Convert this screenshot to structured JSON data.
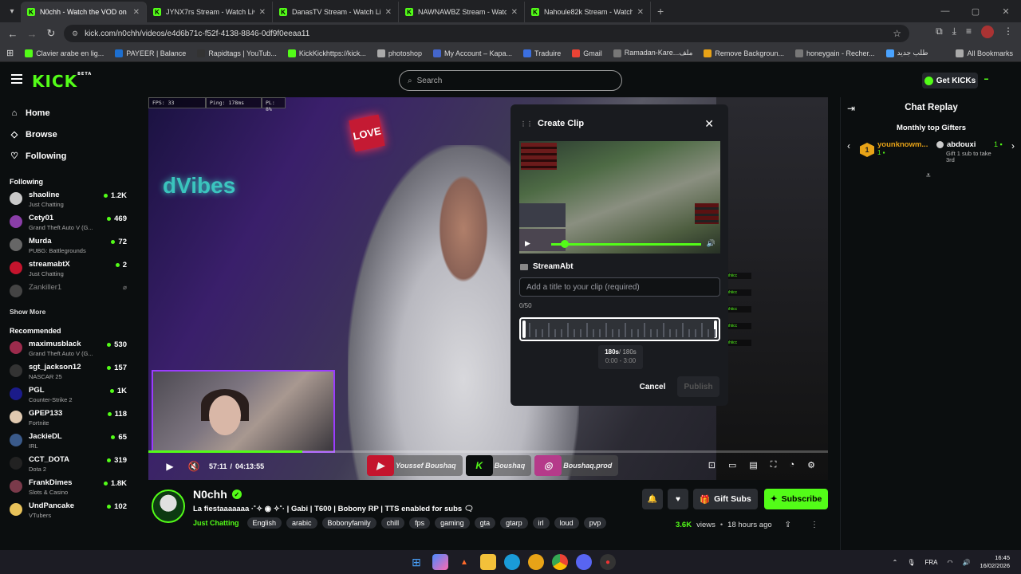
{
  "browser": {
    "tabs": [
      {
        "title": "N0chh - Watch the VOD on Kick",
        "active": true
      },
      {
        "title": "JYNX7rs Stream - Watch Live on",
        "active": false
      },
      {
        "title": "DanasTV Stream - Watch Live o",
        "active": false
      },
      {
        "title": "NAWNAWBZ Stream - Watch Li",
        "active": false
      },
      {
        "title": "Nahoule82k Stream - Watch Liv",
        "active": false
      }
    ],
    "url": "kick.com/n0chh/videos/e4d6b71c-f52f-4138-8846-0df9f0eeaa11",
    "bookmarks": [
      "Clavier arabe en lig...",
      "PAYEER | Balance",
      "Rapidtags | YouTub...",
      "KickKickhttps://kick...",
      "photoshop",
      "My Account – Kapa...",
      "Traduire",
      "Gmail",
      "Ramadan-Kare...ملف",
      "Remove Backgroun...",
      "honeygain - Recher...",
      "طلب جديد"
    ],
    "all_bookmarks": "All Bookmarks"
  },
  "kick": {
    "logo": "KICK",
    "logo_badge": "BETA",
    "search_placeholder": "Search",
    "get_kicks": "Get KICKs",
    "nav": {
      "home": "Home",
      "browse": "Browse",
      "following": "Following"
    },
    "following_title": "Following",
    "following": [
      {
        "name": "shaoline",
        "category": "Just Chatting",
        "viewers": "1.2K",
        "color": "#c9c9c9"
      },
      {
        "name": "Cety01",
        "category": "Grand Theft Auto V (G...",
        "viewers": "469",
        "color": "#8a3ea8"
      },
      {
        "name": "Murda",
        "category": "PUBG: Battlegrounds",
        "viewers": "72",
        "color": "#666"
      },
      {
        "name": "streamabtX",
        "category": "Just Chatting",
        "viewers": "2",
        "color": "#c4142d"
      },
      {
        "name": "Zankiller1",
        "category": "",
        "viewers": "",
        "color": "#444"
      }
    ],
    "show_more": "Show More",
    "recommended_title": "Recommended",
    "recommended": [
      {
        "name": "maximusblack",
        "category": "Grand Theft Auto V (G...",
        "viewers": "530",
        "color": "#9c2b4c"
      },
      {
        "name": "sgt_jackson12",
        "category": "NASCAR 25",
        "viewers": "157",
        "color": "#333"
      },
      {
        "name": "PGL",
        "category": "Counter-Strike 2",
        "viewers": "1K",
        "color": "#1b1b8a"
      },
      {
        "name": "GPEP133",
        "category": "Fortnite",
        "viewers": "118",
        "color": "#e0c9b0"
      },
      {
        "name": "JackieDL",
        "category": "IRL",
        "viewers": "65",
        "color": "#3a5a8a"
      },
      {
        "name": "CCT_DOTA",
        "category": "Dota 2",
        "viewers": "319",
        "color": "#222"
      },
      {
        "name": "FrankDimes",
        "category": "Slots & Casino",
        "viewers": "1.8K",
        "color": "#7a3a4a"
      },
      {
        "name": "UndPancake",
        "category": "VTubers",
        "viewers": "102",
        "color": "#e8c25a"
      }
    ]
  },
  "video": {
    "fps": "FPS: 33",
    "ping": "Ping: 178ms",
    "pl": "PL: 8%",
    "neon": "dVibes",
    "love": "LOVE",
    "time_current": "57:11",
    "time_sep": "/",
    "time_total": "04:13:55",
    "progress_fraction": 0.227,
    "socials": [
      "Youssef Boushaq",
      "Boushaq",
      "Boushaq.prod"
    ],
    "chat_overlay": [
      "Graphiicc",
      "Graphiicc",
      "Graphiicc",
      "Graphiicc",
      "Graphiicc"
    ]
  },
  "clip": {
    "title": "Create Clip",
    "channel": "StreamAbt",
    "input_placeholder": "Add a title to your clip (required)",
    "count": "0/50",
    "duration": "180s",
    "duration_total": "/ 180s",
    "range": "0:00 - 3:00",
    "cancel": "Cancel",
    "publish": "Publish"
  },
  "chat": {
    "title": "Chat Replay",
    "gifters_title": "Monthly top Gifters",
    "gifter1_name": "younknowm...",
    "gifter1_count": "1",
    "gifter1_rank": "1",
    "gifter2_name": "abdouxi",
    "gifter2_count": "1",
    "gifter2_hint": "Gift 1 sub to take 3rd"
  },
  "channel": {
    "name": "N0chh",
    "description": "La fiestaaaaaaa ·˚✧ ◉ ✧˚· | Gabi | T600 | Bobony RP | TTS enabled for subs 🗨",
    "category": "Just Chatting",
    "tags": [
      "English",
      "arabic",
      "Bobonyfamily",
      "chill",
      "fps",
      "gaming",
      "gta",
      "gtarp",
      "irl",
      "loud",
      "pvp"
    ],
    "gift_subs": "Gift Subs",
    "subscribe": "Subscribe",
    "views": "3.6K",
    "views_label": "views",
    "ago": "18 hours ago"
  },
  "taskbar": {
    "lang": "FRA",
    "time": "16:45",
    "date": "16/02/2026"
  }
}
